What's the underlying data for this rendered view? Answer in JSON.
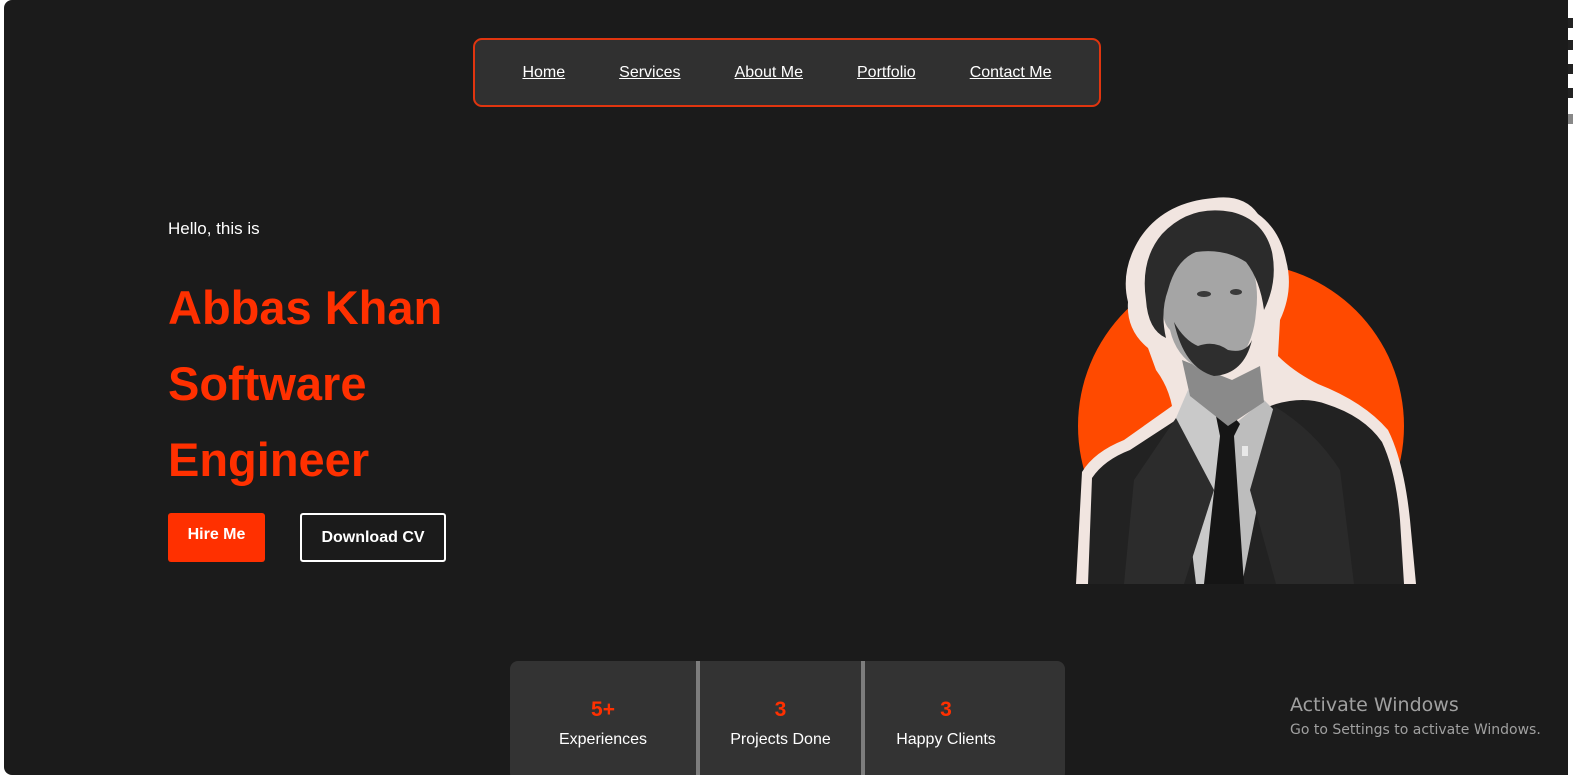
{
  "nav": {
    "items": [
      {
        "label": "Home"
      },
      {
        "label": "Services"
      },
      {
        "label": "About Me"
      },
      {
        "label": "Portfolio"
      },
      {
        "label": "Contact Me"
      }
    ]
  },
  "hero": {
    "greeting": "Hello, this is",
    "name": "Abbas Khan",
    "title_line1": "Software",
    "title_line2": "Engineer",
    "hire_label": "Hire Me",
    "cv_label": "Download CV"
  },
  "stats": [
    {
      "value": "5+",
      "label": "Experiences"
    },
    {
      "value": "3",
      "label": "Projects Done"
    },
    {
      "value": "3",
      "label": "Happy Clients"
    }
  ],
  "watermark": {
    "title": "Activate Windows",
    "subtitle": "Go to Settings to activate Windows."
  },
  "colors": {
    "accent": "#ff3000",
    "background": "#1b1b1b",
    "panel": "#303030",
    "circle": "#ff4a00"
  }
}
